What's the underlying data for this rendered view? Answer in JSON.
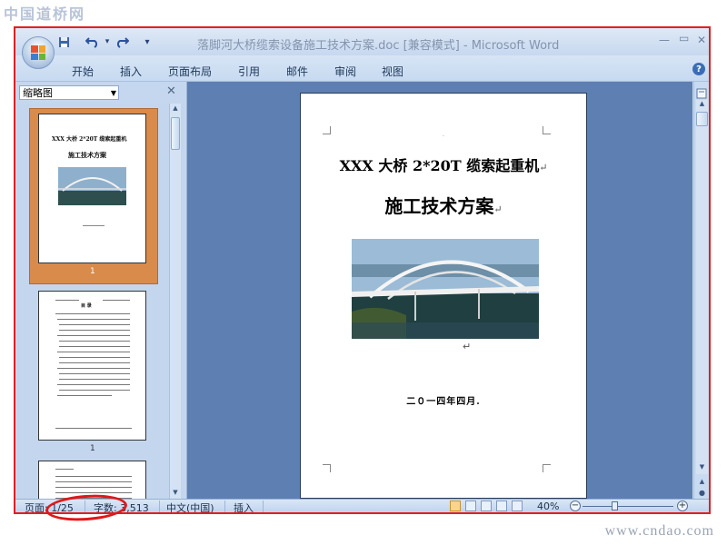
{
  "watermarks": {
    "top": "中国道桥网",
    "bottom": "www.cndao.com"
  },
  "window": {
    "title": "落脚河大桥缆索设备施工技术方案.doc [兼容模式] - Microsoft Word"
  },
  "quick_access": {
    "customize": "▾"
  },
  "ribbon": {
    "tabs": [
      "开始",
      "插入",
      "页面布局",
      "引用",
      "邮件",
      "审阅",
      "视图"
    ]
  },
  "nav_pane": {
    "view_label": "缩略图",
    "thumbnails": [
      {
        "page_number": "1",
        "line1": "XXX 大桥 2*20T 缆索起重机",
        "line2": "施工技术方案"
      },
      {
        "page_number": "1",
        "heading": "目    录"
      }
    ]
  },
  "document": {
    "title_line1": "XXX 大桥 2*20T 缆索起重机",
    "title_line2": "施工技术方案",
    "date": "二０一四年四月.",
    "para_mark": "↵"
  },
  "statusbar": {
    "page": "页面: 1/25",
    "words": "字数: 3,513",
    "language": "中文(中国)",
    "mode": "插入",
    "zoom": "40%",
    "zoom_level": 0.4
  }
}
